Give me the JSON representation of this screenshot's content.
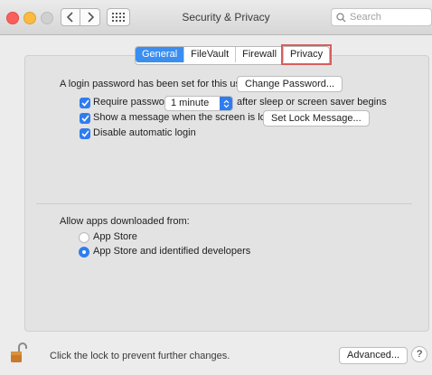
{
  "window": {
    "title": "Security & Privacy",
    "search_placeholder": "Search"
  },
  "tabs": [
    {
      "label": "General",
      "active": true
    },
    {
      "label": "FileVault",
      "active": false
    },
    {
      "label": "Firewall",
      "active": false
    },
    {
      "label": "Privacy",
      "active": false,
      "highlighted": true
    }
  ],
  "general": {
    "login_password_text": "A login password has been set for this user",
    "change_password_button": "Change Password...",
    "require_password": {
      "checked": true,
      "label": "Require password",
      "select_value": "1 minute",
      "suffix": "after sleep or screen saver begins"
    },
    "show_message": {
      "checked": true,
      "label": "Show a message when the screen is locked",
      "button": "Set Lock Message..."
    },
    "disable_login": {
      "checked": true,
      "label": "Disable automatic login"
    }
  },
  "downloads": {
    "label": "Allow apps downloaded from:",
    "options": [
      {
        "label": "App Store",
        "selected": false
      },
      {
        "label": "App Store and identified developers",
        "selected": true
      }
    ]
  },
  "footer": {
    "lock_text": "Click the lock to prevent further changes.",
    "advanced_button": "Advanced...",
    "help_label": "?"
  },
  "colors": {
    "accent": "#2f7cf0",
    "highlight_border": "#d95d5d"
  }
}
